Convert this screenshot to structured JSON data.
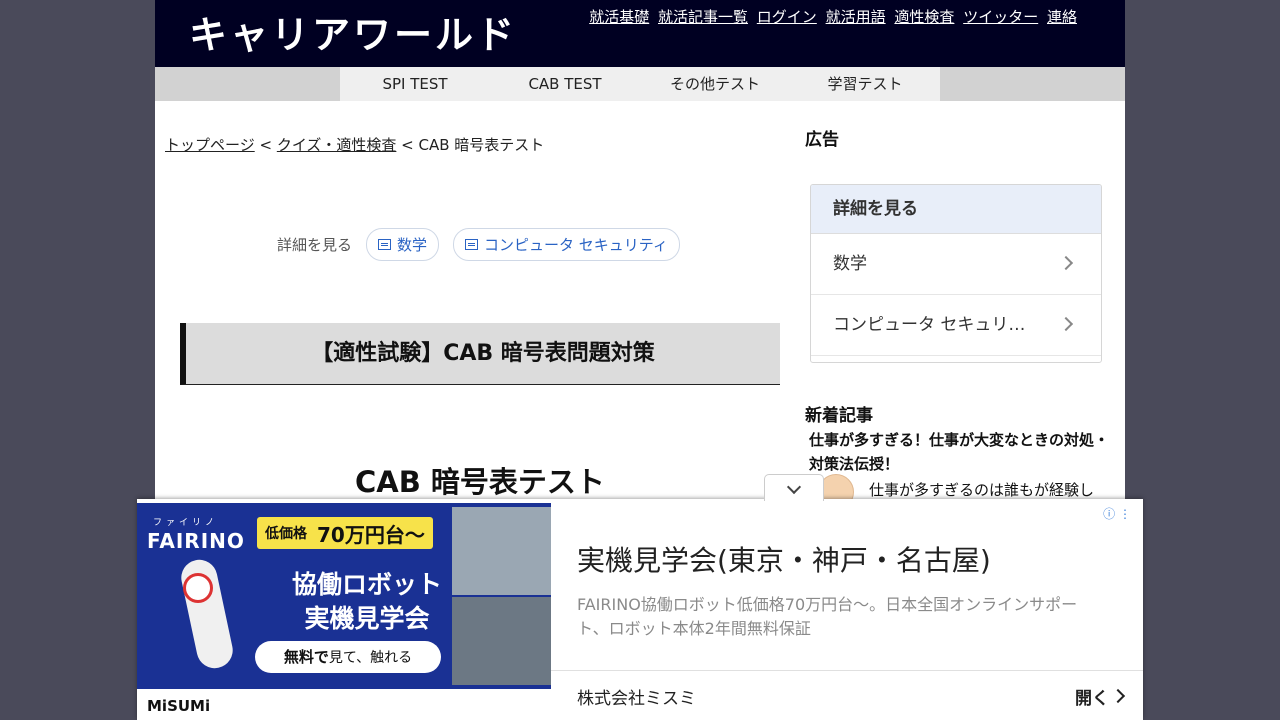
{
  "site": {
    "logo": "キャリアワールド",
    "top_nav": [
      "就活基礎",
      "就活記事一覧",
      "ログイン",
      "就活用語",
      "適性検査",
      "ツイッター",
      "連絡"
    ]
  },
  "nav_tabs": [
    "SPI TEST",
    "CAB TEST",
    "その他テスト",
    "学習テスト"
  ],
  "breadcrumb": {
    "home": "トップページ",
    "sep1": " < ",
    "category": "クイズ・適性検査",
    "sep2": " < ",
    "current": "CAB 暗号表テスト"
  },
  "detail": {
    "label": "詳細を見る",
    "tags": [
      "数学",
      "コンピュータ セキュリティ"
    ]
  },
  "article": {
    "headline": "【適性試験】CAB 暗号表問題対策",
    "section_title": "CAB 暗号表テスト"
  },
  "sidebar": {
    "ad_label": "広告",
    "card_title": "詳細を見る",
    "card_items": [
      "数学",
      "コンピュータ セキュリ…"
    ],
    "new_label": "新着記事",
    "new_article_title": "仕事が多すぎる！仕事が大変なときの対処・対策法伝授！",
    "new_article_excerpt": "仕事が多すぎるのは誰もが経験し"
  },
  "ad": {
    "brand": "FAIRINO",
    "brand_kana": "ファイリノ",
    "price_label": "低価格",
    "price_value": "70万円台〜",
    "headline_1": "協働ロボット",
    "headline_2": "実機見学会",
    "cta_bold": "無料で",
    "cta_rest": "見て、触れる",
    "sponsor_logo": "MiSUMi",
    "title": "実機見学会(東京・神戸・名古屋)",
    "description": "FAIRINO協働ロボット低価格70万円台〜。日本全国オンラインサポート、ロボット本体2年間無料保証",
    "advertiser": "株式会社ミスミ",
    "open_label": "開く",
    "info_icon": "ⓘ ⋮"
  }
}
